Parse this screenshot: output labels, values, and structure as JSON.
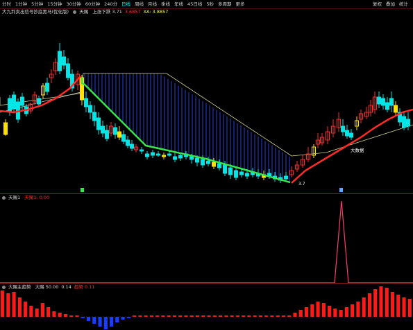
{
  "toolbar": {
    "items": [
      "分时",
      "1分钟",
      "5分钟",
      "15分钟",
      "30分钟",
      "60分钟",
      "240分",
      "日线",
      "周线",
      "月线",
      "季线",
      "年线",
      "45日线",
      "5秒",
      "多周期",
      "更多"
    ],
    "active_index": 7,
    "right": [
      "复权",
      "叠加",
      "统计"
    ]
  },
  "main_panel": {
    "title": "大九判卖出信号抄底黑马(优化版)",
    "params": [
      {
        "label": "天赐",
        "value": "",
        "color": "#d8d8d8"
      },
      {
        "label": "上涨下跌",
        "value": "3.71",
        "color": "#d8d8d8"
      },
      {
        "label": "",
        "value": "3.6857",
        "color": "#ff3030"
      },
      {
        "label": "XA:",
        "value": "3.8857",
        "color": "#ffff66"
      }
    ],
    "annotations": [
      {
        "text": "大数据",
        "color": "#ffffff"
      },
      {
        "text": "3.7",
        "color": "#ffffff"
      }
    ]
  },
  "panel2": {
    "title": "天赐1",
    "series_label": "天赐1:",
    "value": "0.00",
    "label_color": "#ff3030"
  },
  "panel3": {
    "title": "大赐主趋势",
    "params": [
      {
        "label": "大赐",
        "value": "50.00",
        "color": "#d8d8d8"
      },
      {
        "label": "",
        "value": "0.14",
        "color": "#d8d8d8"
      },
      {
        "label": "趋势",
        "value": "0.11",
        "color": "#ff3030"
      }
    ]
  },
  "colors": {
    "up": "#ff2a2a",
    "down": "#00e5e5",
    "yellow": "#ffe000",
    "green_line": "#39e64a",
    "cloud": "#2c3fd6",
    "axis": "#8c1f1f"
  }
}
